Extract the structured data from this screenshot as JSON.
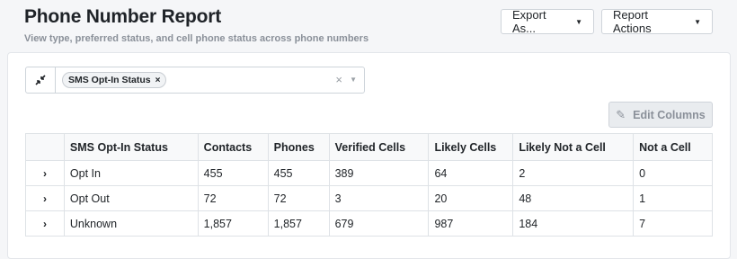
{
  "header": {
    "title": "Phone Number Report",
    "subtitle": "View type, preferred status, and cell phone status across phone numbers",
    "export_label": "Export As...",
    "actions_label": "Report Actions"
  },
  "filter": {
    "tag_label": "SMS Opt-In Status",
    "tag_remove": "×",
    "clear": "×",
    "dropdown": "▼",
    "collapse": "⤡"
  },
  "toolbar": {
    "edit_columns_label": "Edit Columns"
  },
  "table": {
    "headers": [
      "SMS Opt-In Status",
      "Contacts",
      "Phones",
      "Verified Cells",
      "Likely Cells",
      "Likely Not a Cell",
      "Not a Cell"
    ],
    "rows": [
      {
        "expand": "›",
        "cells": [
          "Opt In",
          "455",
          "455",
          "389",
          "64",
          "2",
          "0"
        ]
      },
      {
        "expand": "›",
        "cells": [
          "Opt Out",
          "72",
          "72",
          "3",
          "20",
          "48",
          "1"
        ]
      },
      {
        "expand": "›",
        "cells": [
          "Unknown",
          "1,857",
          "1,857",
          "679",
          "987",
          "184",
          "7"
        ]
      }
    ]
  },
  "icons": {
    "collapse": "collapse-arrows-icon",
    "edit": "pencil-icon",
    "caret": "caret-down-icon",
    "expand": "chevron-right-icon"
  },
  "colors": {
    "background": "#f5f6f8",
    "disabled_button": "#e9ecef",
    "header_row": "#f8f9fa"
  }
}
